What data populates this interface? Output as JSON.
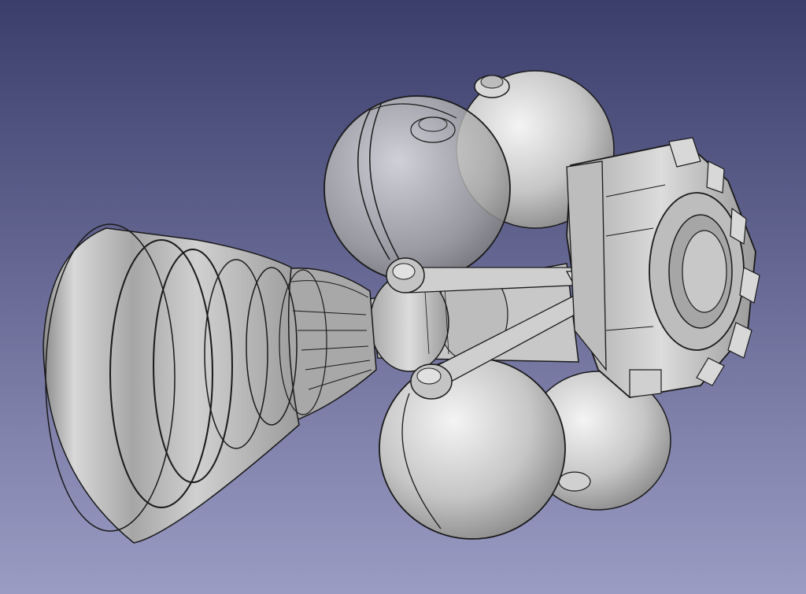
{
  "viewport": {
    "background_top": "#3b3d6b",
    "background_bottom": "#9a9cc4",
    "shading_light": "#eeeeee",
    "shading_mid": "#b4b4b4",
    "shading_dark": "#6e6e6e",
    "edge_color": "#1a1a1a"
  },
  "model": {
    "parts": [
      {
        "name": "nozzle-bell"
      },
      {
        "name": "nozzle-throat"
      },
      {
        "name": "combustion-chamber"
      },
      {
        "name": "propellant-tank-upper-left"
      },
      {
        "name": "propellant-tank-upper-right"
      },
      {
        "name": "propellant-tank-lower-left"
      },
      {
        "name": "propellant-tank-lower-right"
      },
      {
        "name": "support-strut-upper"
      },
      {
        "name": "support-strut-lower"
      },
      {
        "name": "strut-bracket"
      },
      {
        "name": "thrust-ring"
      }
    ]
  }
}
